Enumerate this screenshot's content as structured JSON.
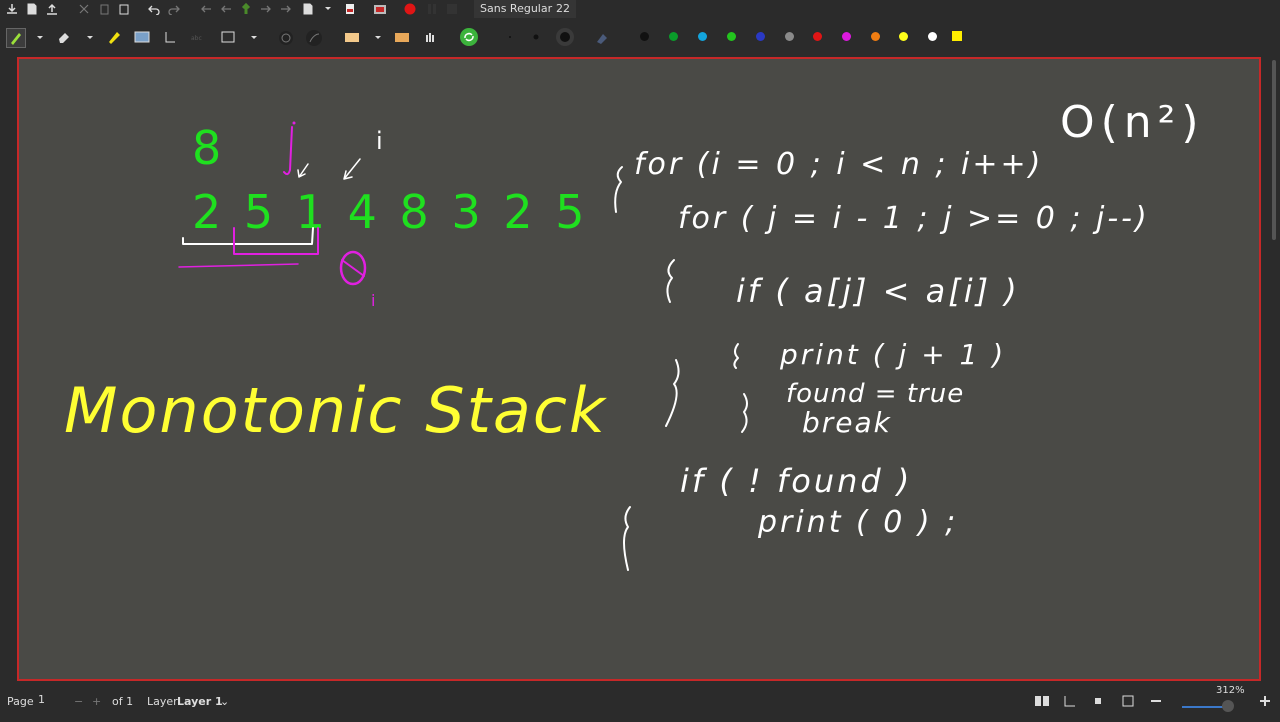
{
  "app": {
    "font_name": "Sans Regular",
    "font_size": "22",
    "zoom": "312%"
  },
  "toolbar_icons": {
    "row1": [
      "save-icon",
      "new-page-icon",
      "export-icon",
      "cut-icon",
      "copy-icon",
      "paste-icon",
      "undo-icon",
      "redo-icon",
      "nav-first-icon",
      "nav-prev-icon",
      "nav-up-icon",
      "nav-next-icon",
      "nav-last-icon",
      "new-page-after-icon",
      "pdf-icon",
      "fullscreen-icon",
      "record-icon",
      "pause-icon",
      "stop-icon"
    ],
    "row2": [
      "pen-icon",
      "eraser-icon",
      "highlighter-icon",
      "image-icon",
      "text-icon",
      "shapes-icon",
      "rectangle-icon",
      "lasso-icon",
      "hand-icon",
      "refresh-icon",
      "fine-dot-icon",
      "medium-dot-icon",
      "thick-dot-icon"
    ]
  },
  "palette": [
    "#111111",
    "#0a9c2a",
    "#13a4dc",
    "#23c41e",
    "#2a39c4",
    "#8a8a8a",
    "#e01515",
    "#dd1adf",
    "#f07d12",
    "#ffff1a",
    "#ffffff",
    "#ffee00"
  ],
  "canvas": {
    "bg": "#4a4a46",
    "border": "#c62828",
    "ink": {
      "green": "#1fe01f",
      "magenta": "#e020e0",
      "yellow": "#ffff33",
      "white": "#ffffff"
    },
    "texts": {
      "top_number": "8",
      "array": "2 5 1 4 8 3 2 5",
      "label_i": "i",
      "label_j": "j",
      "zero": "0",
      "zero_sub": "i",
      "title": "Monotonic Stack",
      "big_o": "O(n²)",
      "code": [
        "for (i = 0 ; i < n ; i++)",
        "for ( j = i - 1 ; j >= 0 ; j--)",
        "if ( a[j] < a[i] )",
        "print ( j + 1 )",
        "found = true",
        "break",
        "if ( ! found )",
        "print ( 0 ) ;"
      ]
    }
  },
  "status": {
    "page_label": "Page",
    "page_value": "1",
    "of_label": "of 1",
    "layer_label": "Layer",
    "layer_value": "Layer 1"
  }
}
